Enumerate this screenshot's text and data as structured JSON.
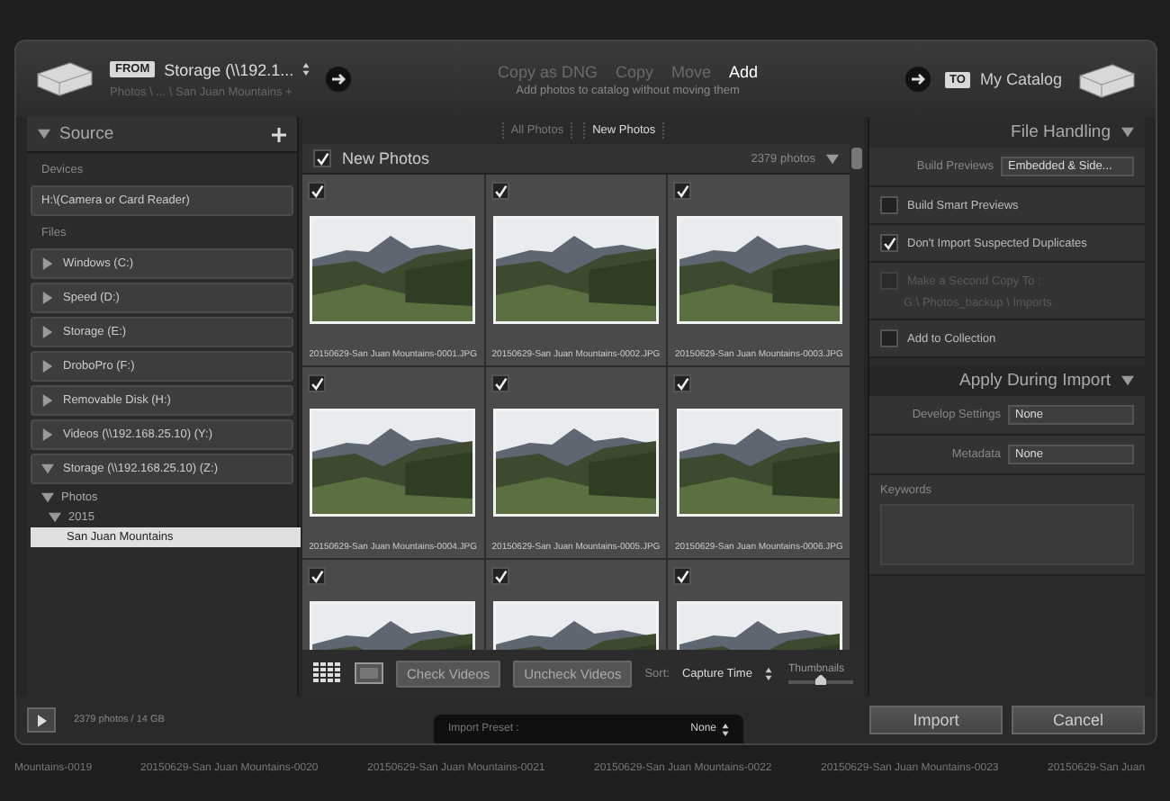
{
  "header": {
    "from_label": "FROM",
    "source_name": "Storage (\\\\192.1...",
    "source_path": "Photos \\ ... \\ San Juan Mountains +",
    "modes": [
      {
        "label": "Copy as DNG",
        "selected": false
      },
      {
        "label": "Copy",
        "selected": false
      },
      {
        "label": "Move",
        "selected": false
      },
      {
        "label": "Add",
        "selected": true
      }
    ],
    "mode_hint": "Add photos to catalog without moving them",
    "to_label": "TO",
    "destination": "My Catalog"
  },
  "source_panel": {
    "title": "Source",
    "devices_heading": "Devices",
    "devices": [
      "H:\\(Camera or Card Reader)"
    ],
    "files_heading": "Files",
    "volumes": [
      {
        "label": "Windows (C:)",
        "expanded": false
      },
      {
        "label": "Speed (D:)",
        "expanded": false
      },
      {
        "label": "Storage (E:)",
        "expanded": false
      },
      {
        "label": "DroboPro (F:)",
        "expanded": false
      },
      {
        "label": "Removable Disk (H:)",
        "expanded": false
      },
      {
        "label": "Videos (\\\\192.168.25.10) (Y:)",
        "expanded": false
      },
      {
        "label": "Storage (\\\\192.168.25.10) (Z:)",
        "expanded": true,
        "children": [
          {
            "label": "Photos",
            "selected": false,
            "children": [
              {
                "label": "2015",
                "selected": false,
                "children": [
                  {
                    "label": "San Juan Mountains",
                    "selected": true
                  }
                ]
              }
            ]
          }
        ]
      }
    ]
  },
  "center": {
    "tabs": [
      {
        "label": "All Photos",
        "selected": false
      },
      {
        "label": "New Photos",
        "selected": true
      }
    ],
    "group": {
      "title": "New Photos",
      "checked": true,
      "count": "2379 photos"
    },
    "photos": [
      {
        "checked": true,
        "filename": "20150629-San Juan Mountains-0001.JPG"
      },
      {
        "checked": true,
        "filename": "20150629-San Juan Mountains-0002.JPG"
      },
      {
        "checked": true,
        "filename": "20150629-San Juan Mountains-0003.JPG"
      },
      {
        "checked": true,
        "filename": "20150629-San Juan Mountains-0004.JPG"
      },
      {
        "checked": true,
        "filename": "20150629-San Juan Mountains-0005.JPG"
      },
      {
        "checked": true,
        "filename": "20150629-San Juan Mountains-0006.JPG"
      },
      {
        "checked": true
      },
      {
        "checked": true
      },
      {
        "checked": true
      }
    ],
    "toolbar": {
      "check_videos": "Check Videos",
      "uncheck_videos": "Uncheck Videos",
      "sort_label": "Sort:",
      "sort_value": "Capture Time",
      "thumbnails_label": "Thumbnails",
      "thumbnail_size": {
        "level": 0.5
      }
    }
  },
  "right_panel": {
    "file_handling": {
      "title": "File Handling",
      "build_previews_label": "Build Previews",
      "build_previews_value": "Embedded & Side...",
      "options": [
        {
          "label": "Build Smart Previews",
          "checked": false,
          "disabled": false
        },
        {
          "label": "Don't Import Suspected Duplicates",
          "checked": true,
          "disabled": false
        },
        {
          "label": "Make a Second Copy To :",
          "checked": false,
          "disabled": true,
          "path": "G:\\ Photos_backup \\ Imports"
        },
        {
          "label": "Add to Collection",
          "checked": false,
          "disabled": false
        }
      ]
    },
    "apply_during_import": {
      "title": "Apply During Import",
      "settings": [
        {
          "label": "Develop Settings",
          "value": "None"
        },
        {
          "label": "Metadata",
          "value": "None"
        }
      ],
      "keywords_label": "Keywords"
    }
  },
  "bottom_bar": {
    "summary": "2379 photos / 14 GB",
    "preset_label": "Import Preset :",
    "preset_value": "None",
    "buttons": [
      "Import",
      "Cancel"
    ]
  },
  "background_filenames": [
    "Mountains-0019",
    "20150629-San Juan Mountains-0020",
    "20150629-San Juan Mountains-0021",
    "20150629-San Juan Mountains-0022",
    "20150629-San Juan Mountains-0023",
    "20150629-San Juan"
  ]
}
